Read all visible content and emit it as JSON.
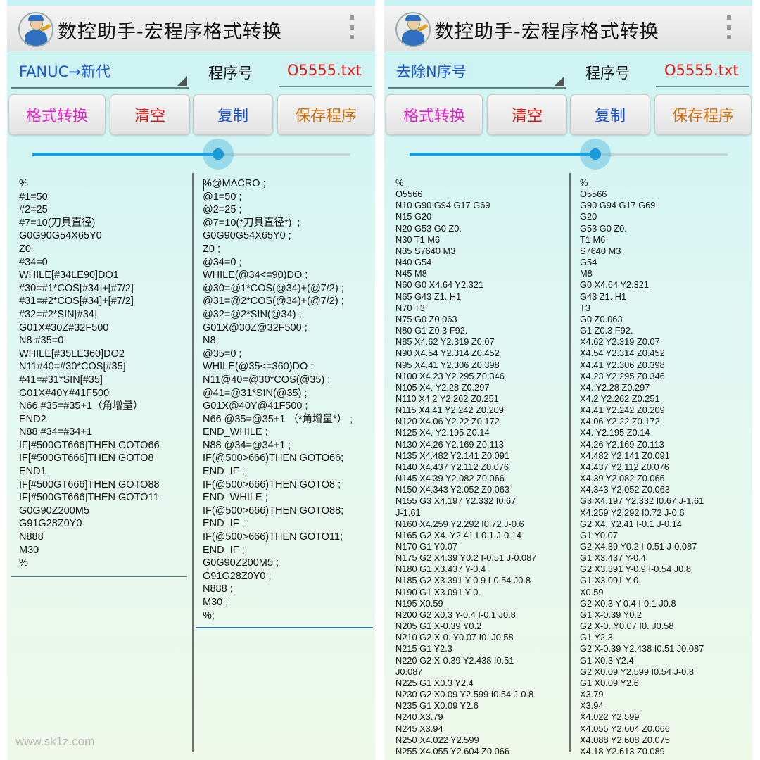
{
  "watermark": "www.sk1z.com",
  "left_panel": {
    "title": "数控助手-宏程序格式转换",
    "mode": "FANUC→新代",
    "program_label": "程序号",
    "program_file": "O5555.txt",
    "buttons": {
      "convert": "格式转换",
      "clear": "清空",
      "copy": "复制",
      "save": "保存程序"
    },
    "original_code": [
      "%",
      "#1=50",
      "#2=25",
      "#7=10(刀具直径)",
      "G0G90G54X65Y0",
      "Z0",
      "#34=0",
      "WHILE[#34LE90]DO1",
      "#30=#1*COS[#34]+[#7/2]",
      "#31=#2*COS[#34]+[#7/2]",
      "#32=#2*SIN[#34]",
      "G01X#30Z#32F500",
      "N8 #35=0",
      "WHILE[#35LE360]DO2",
      "N11#40=#30*COS[#35]",
      "#41=#31*SIN[#35]",
      "G01X#40Y#41F500",
      "N66 #35=#35+1（角增量）",
      "END2",
      "N88 #34=#34+1",
      "IF[#500GT666]THEN GOTO66",
      "IF[#500GT666]THEN GOTO8",
      "END1",
      "IF[#500GT666]THEN GOTO88",
      "IF[#500GT666]THEN GOTO11",
      "G0G90Z200M5",
      "G91G28Z0Y0",
      "N888",
      "M30",
      "%"
    ],
    "converted_code": [
      "%@MACRO ;",
      "@1=50 ;",
      "@2=25 ;",
      "@7=10(*刀具直径*)  ;",
      "G0G90G54X65Y0 ;",
      "Z0 ;",
      "@34=0 ;",
      "WHILE(@34<=90)DO ;",
      "@30=@1*COS(@34)+(@7/2) ;",
      "@31=@2*COS(@34)+(@7/2) ;",
      "@32=@2*SIN(@34) ;",
      "G01X@30Z@32F500 ;",
      "N8;",
      "@35=0 ;",
      "WHILE(@35<=360)DO ;",
      "N11@40=@30*COS(@35) ;",
      "@41=@31*SIN(@35) ;",
      "G01X@40Y@41F500 ;",
      "N66 @35=@35+1 （*角增量*） ;",
      "END_WHILE ;",
      "N88 @34=@34+1 ;",
      "IF(@500>666)THEN GOTO66;",
      "END_IF ;",
      "IF(@500>666)THEN GOTO8 ;",
      "END_WHILE ;",
      "IF(@500>666)THEN GOTO88;",
      "END_IF ;",
      "IF(@500>666)THEN GOTO11;",
      "END_IF ;",
      "G0G90Z200M5 ;",
      "G91G28Z0Y0 ;",
      "N888 ;",
      "M30 ;",
      "%;"
    ]
  },
  "right_panel": {
    "title": "数控助手-宏程序格式转换",
    "mode": "去除N序号",
    "program_label": "程序号",
    "program_file": "O5555.txt",
    "buttons": {
      "convert": "格式转换",
      "clear": "清空",
      "copy": "复制",
      "save": "保存程序"
    },
    "original_code": [
      "%",
      "O5566",
      "N10 G90 G94 G17 G69",
      "N15 G20",
      "N20 G53 G0 Z0.",
      "N30 T1 M6",
      "N35 S7640 M3",
      "N40 G54",
      "N45 M8",
      "N60 G0 X4.64 Y2.321",
      "N65 G43 Z1. H1",
      "N70 T3",
      "N75 G0 Z0.063",
      "N80 G1 Z0.3 F92.",
      "N85 X4.62 Y2.319 Z0.07",
      "N90 X4.54 Y2.314 Z0.452",
      "N95 X4.41 Y2.306 Z0.398",
      "N100 X4.23 Y2.295 Z0.346",
      "N105 X4. Y2.28 Z0.297",
      "N110 X4.2 Y2.262 Z0.251",
      "N115 X4.41 Y2.242 Z0.209",
      "N120 X4.06 Y2.22 Z0.172",
      "N125 X4. Y2.195 Z0.14",
      "N130 X4.26 Y2.169 Z0.113",
      "N135 X4.482 Y2.141 Z0.091",
      "N140 X4.437 Y2.112 Z0.076",
      "N145 X4.39 Y2.082 Z0.066",
      "N150 X4.343 Y2.052 Z0.063",
      "N155 G3 X4.197 Y2.332 I0.67",
      "J-1.61",
      "N160 X4.259 Y2.292 I0.72 J-0.6",
      "N165 G2 X4. Y2.41 I-0.1 J-0.14",
      "N170 G1 Y0.07",
      "N175 G2 X4.39 Y0.2 I-0.51 J-0.087",
      "N180 G1 X3.437 Y-0.4",
      "N185 G2 X3.391 Y-0.9 I-0.54 J0.8",
      "N190 G1 X3.091 Y-0.",
      "N195 X0.59",
      "N200 G2 X0.3 Y-0.4 I-0.1 J0.8",
      "N205 G1 X-0.39 Y0.2",
      "N210 G2 X-0. Y0.07 I0. J0.58",
      "N215 G1 Y2.3",
      "N220 G2 X-0.39 Y2.438 I0.51",
      "J0.087",
      "N225 G1 X0.3 Y2.4",
      "N230 G2 X0.09 Y2.599 I0.54 J-0.8",
      "N235 G1 X0.09 Y2.6",
      "N240 X3.79",
      "N245 X3.94",
      "N250 X4.022 Y2.599",
      "N255 X4.055 Y2.604 Z0.066"
    ],
    "converted_code": [
      "%",
      "O5566",
      "G90 G94 G17 G69",
      "G20",
      "G53 G0 Z0.",
      "T1 M6",
      "S7640 M3",
      "G54",
      "M8",
      "G0 X4.64 Y2.321",
      "G43 Z1. H1",
      "T3",
      "G0 Z0.063",
      "G1 Z0.3 F92.",
      "X4.62 Y2.319 Z0.07",
      "X4.54 Y2.314 Z0.452",
      "X4.41 Y2.306 Z0.398",
      "X4.23 Y2.295 Z0.346",
      "X4. Y2.28 Z0.297",
      "X4.2 Y2.262 Z0.251",
      "X4.41 Y2.242 Z0.209",
      "X4.06 Y2.22 Z0.172",
      "X4. Y2.195 Z0.14",
      "X4.26 Y2.169 Z0.113",
      "X4.482 Y2.141 Z0.091",
      "X4.437 Y2.112 Z0.076",
      "X4.39 Y2.082 Z0.066",
      "X4.343 Y2.052 Z0.063",
      "G3 X4.197 Y2.332 I0.67 J-1.61",
      "X4.259 Y2.292 I0.72 J-0.6",
      "G2 X4. Y2.41 I-0.1 J-0.14",
      "G1 Y0.07",
      "G2 X4.39 Y0.2 I-0.51 J-0.087",
      "G1 X3.437 Y-0.4",
      "G2 X3.391 Y-0.9 I-0.54 J0.8",
      "G1 X3.091 Y-0.",
      "X0.59",
      "G2 X0.3 Y-0.4 I-0.1 J0.8",
      "G1 X-0.39 Y0.2",
      "G2 X-0. Y0.07 I0. J0.58",
      "G1 Y2.3",
      "G2 X-0.39 Y2.438 I0.51 J0.087",
      "G1 X0.3 Y2.4",
      "G2 X0.09 Y2.599 I0.54 J-0.8",
      "G1 X0.09 Y2.6",
      "X3.79",
      "X3.94",
      "X4.022 Y2.599",
      "X4.055 Y2.604 Z0.066",
      "X4.088 Y2.608 Z0.075",
      "X4.18 Y2.613 Z0.089"
    ]
  }
}
